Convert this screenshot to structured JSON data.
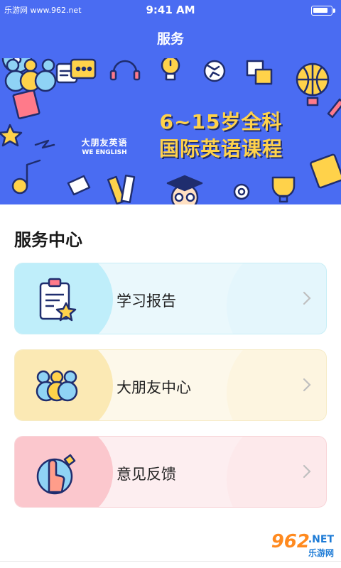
{
  "status_bar": {
    "watermark": "乐游网 www.962.net",
    "time": "9:41 AM"
  },
  "nav": {
    "title": "服务"
  },
  "banner": {
    "logo_cn": "大朋友英语",
    "logo_en": "WE ENGLISH",
    "slogan_line1": "6~15岁全科",
    "slogan_line2": "国际英语课程",
    "slogan_color": "#ffd24a"
  },
  "section": {
    "title": "服务中心"
  },
  "cards": [
    {
      "label": "学习报告",
      "icon": "clipboard-star-icon"
    },
    {
      "label": "大朋友中心",
      "icon": "logo-circles-icon"
    },
    {
      "label": "意见反馈",
      "icon": "hand-feedback-icon"
    }
  ],
  "footer_watermark": {
    "number": "962",
    "net": ".NET",
    "cn": "乐游网"
  },
  "colors": {
    "primary": "#4a6cf2",
    "report_accent": "#bfeefa",
    "center_accent": "#fbe9b4",
    "feedback_accent": "#fbc7cd"
  }
}
